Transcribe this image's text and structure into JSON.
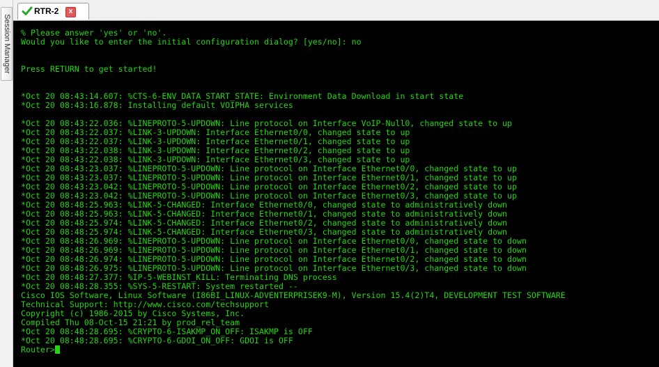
{
  "side_panel": {
    "label": "Session Manager"
  },
  "tab": {
    "title": "RTR-2",
    "close_glyph": "x",
    "status_icon": "check-icon"
  },
  "colors": {
    "terminal_bg": "#000000",
    "terminal_fg": "#23d60f"
  },
  "terminal": {
    "lines": [
      "% Please answer 'yes' or 'no'.",
      "Would you like to enter the initial configuration dialog? [yes/no]: no",
      "",
      "",
      "Press RETURN to get started!",
      "",
      "",
      "*Oct 20 08:43:14.607: %CTS-6-ENV_DATA_START_STATE: Environment Data Download in start state",
      "*Oct 20 08:43:16.878: Installing default VOIPHA services",
      "",
      "*Oct 20 08:43:22.036: %LINEPROTO-5-UPDOWN: Line protocol on Interface VoIP-Null0, changed state to up",
      "*Oct 20 08:43:22.037: %LINK-3-UPDOWN: Interface Ethernet0/0, changed state to up",
      "*Oct 20 08:43:22.037: %LINK-3-UPDOWN: Interface Ethernet0/1, changed state to up",
      "*Oct 20 08:43:22.038: %LINK-3-UPDOWN: Interface Ethernet0/2, changed state to up",
      "*Oct 20 08:43:22.038: %LINK-3-UPDOWN: Interface Ethernet0/3, changed state to up",
      "*Oct 20 08:43:23.037: %LINEPROTO-5-UPDOWN: Line protocol on Interface Ethernet0/0, changed state to up",
      "*Oct 20 08:43:23.037: %LINEPROTO-5-UPDOWN: Line protocol on Interface Ethernet0/1, changed state to up",
      "*Oct 20 08:43:23.042: %LINEPROTO-5-UPDOWN: Line protocol on Interface Ethernet0/2, changed state to up",
      "*Oct 20 08:43:23.042: %LINEPROTO-5-UPDOWN: Line protocol on Interface Ethernet0/3, changed state to up",
      "*Oct 20 08:48:25.963: %LINK-5-CHANGED: Interface Ethernet0/0, changed state to administratively down",
      "*Oct 20 08:48:25.963: %LINK-5-CHANGED: Interface Ethernet0/1, changed state to administratively down",
      "*Oct 20 08:48:25.974: %LINK-5-CHANGED: Interface Ethernet0/2, changed state to administratively down",
      "*Oct 20 08:48:25.974: %LINK-5-CHANGED: Interface Ethernet0/3, changed state to administratively down",
      "*Oct 20 08:48:26.969: %LINEPROTO-5-UPDOWN: Line protocol on Interface Ethernet0/0, changed state to down",
      "*Oct 20 08:48:26.969: %LINEPROTO-5-UPDOWN: Line protocol on Interface Ethernet0/1, changed state to down",
      "*Oct 20 08:48:26.974: %LINEPROTO-5-UPDOWN: Line protocol on Interface Ethernet0/2, changed state to down",
      "*Oct 20 08:48:26.975: %LINEPROTO-5-UPDOWN: Line protocol on Interface Ethernet0/3, changed state to down",
      "*Oct 20 08:48:27.377: %IP-5-WEBINST_KILL: Terminating DNS process",
      "*Oct 20 08:48:28.355: %SYS-5-RESTART: System restarted --",
      "Cisco IOS Software, Linux Software (I86BI_LINUX-ADVENTERPRISEK9-M), Version 15.4(2)T4, DEVELOPMENT TEST SOFTWARE",
      "Technical Support: http://www.cisco.com/techsupport",
      "Copyright (c) 1986-2015 by Cisco Systems, Inc.",
      "Compiled Thu 08-Oct-15 21:21 by prod_rel_team",
      "*Oct 20 08:48:28.695: %CRYPTO-6-ISAKMP_ON_OFF: ISAKMP is OFF",
      "*Oct 20 08:48:28.695: %CRYPTO-6-GDOI_ON_OFF: GDOI is OFF"
    ],
    "prompt": "Router>"
  }
}
